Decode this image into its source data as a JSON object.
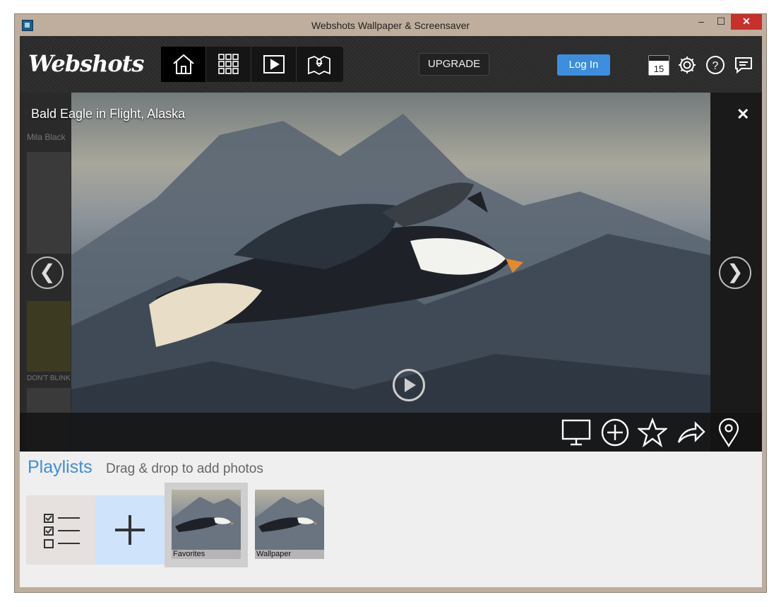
{
  "window": {
    "title": "Webshots Wallpaper & Screensaver",
    "min_label": "–",
    "max_label": "☐",
    "close_label": "✕"
  },
  "topbar": {
    "logo": "Webshots",
    "nav": [
      "home-icon",
      "grid-icon",
      "slideshow-icon",
      "map-icon"
    ],
    "upgrade_label": "UPGRADE",
    "login_label": "Log In",
    "calendar_day": "15",
    "icons": [
      "calendar-icon",
      "gear-icon",
      "help-icon",
      "chat-icon"
    ]
  },
  "viewer": {
    "title": "Bald Eagle in Flight, Alaska",
    "ghost_author": "Mila Black",
    "ghost_caption": "DON'T BLINK",
    "prev_label": "❮",
    "next_label": "❯",
    "close_label": "✕",
    "actions": [
      "monitor-icon",
      "add-circle-icon",
      "star-icon",
      "share-icon",
      "location-pin-icon"
    ]
  },
  "playlists": {
    "title": "Playlists",
    "subtitle": "Drag & drop to add photos",
    "items": [
      {
        "label": "Favorites",
        "selected": true
      },
      {
        "label": "Wallpaper",
        "selected": false
      }
    ]
  },
  "colors": {
    "accent": "#3d8ede",
    "close_red": "#c7302b"
  }
}
